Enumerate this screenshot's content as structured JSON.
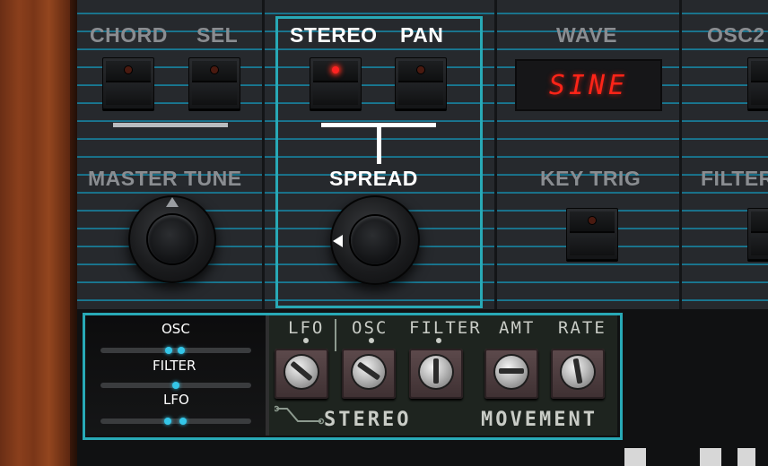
{
  "top_panel": {
    "labels": {
      "chord": "CHORD",
      "sel": "SEL",
      "stereo": "STEREO",
      "pan": "PAN",
      "wave": "WAVE",
      "osc2": "OSC2",
      "master_tune": "MASTER TUNE",
      "spread": "SPREAD",
      "key_trig": "KEY TRIG",
      "filter": "FILTER"
    },
    "wave_display": "SINE",
    "stereo_led": "on",
    "pan_led": "off"
  },
  "modulation": {
    "sliders": [
      {
        "label": "OSC"
      },
      {
        "label": "FILTER"
      },
      {
        "label": "LFO"
      }
    ],
    "column_labels": {
      "lfo": "LFO",
      "osc": "OSC",
      "filter": "FILTER",
      "amt": "AMT",
      "rate": "RATE"
    },
    "group_labels": {
      "stereo": "STEREO",
      "movement": "MOVEMENT"
    }
  },
  "colors": {
    "highlight": "#28a9b6",
    "stripe": "#1b8fae",
    "led_on": "#ff2222",
    "display_text": "#ff2418",
    "slider_dot": "#34c6e8"
  }
}
